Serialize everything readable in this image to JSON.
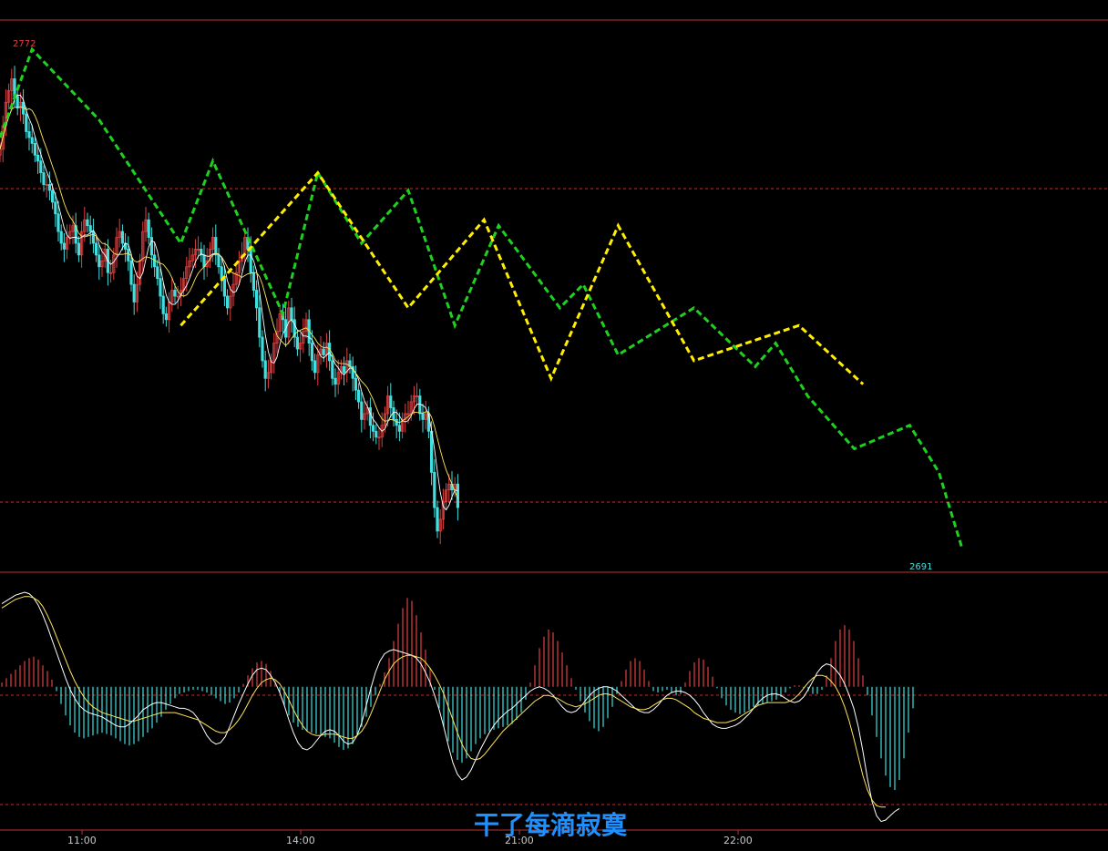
{
  "chart_data": {
    "type": "line",
    "price_panel": {
      "high_label": "2772",
      "low_label": "2691",
      "ylim": [
        2686,
        2780
      ],
      "close": [
        2758,
        2762,
        2766,
        2768,
        2770,
        2767,
        2765,
        2766,
        2764,
        2761,
        2760,
        2759,
        2757,
        2756,
        2754,
        2752,
        2752,
        2751,
        2749,
        2747,
        2744,
        2742,
        2741,
        2743,
        2744,
        2745,
        2742,
        2740,
        2744,
        2746,
        2745,
        2744,
        2742,
        2740,
        2738,
        2739,
        2741,
        2737,
        2737,
        2740,
        2743,
        2744,
        2742,
        2741,
        2739,
        2735,
        2732,
        2735,
        2739,
        2744,
        2746,
        2743,
        2740,
        2738,
        2736,
        2733,
        2730,
        2729,
        2732,
        2734,
        2733,
        2733,
        2734,
        2736,
        2738,
        2739,
        2740,
        2741,
        2741,
        2740,
        2738,
        2739,
        2741,
        2743,
        2740,
        2738,
        2736,
        2733,
        2731,
        2733,
        2735,
        2737,
        2739,
        2740,
        2743,
        2741,
        2737,
        2734,
        2731,
        2726,
        2722,
        2719,
        2720,
        2722,
        2725,
        2727,
        2730,
        2729,
        2726,
        2731,
        2729,
        2726,
        2724,
        2725,
        2727,
        2729,
        2725,
        2722,
        2720,
        2723,
        2724,
        2723,
        2725,
        2722,
        2719,
        2718,
        2720,
        2721,
        2720,
        2722,
        2721,
        2719,
        2717,
        2715,
        2712,
        2713,
        2714,
        2711,
        2710,
        2709,
        2709,
        2711,
        2713,
        2716,
        2714,
        2712,
        2711,
        2710,
        2712,
        2713,
        2713,
        2715,
        2716,
        2716,
        2713,
        2712,
        2713,
        2710,
        2703,
        2697,
        2693,
        2695,
        2698,
        2700,
        2701,
        2700,
        2701,
        2697
      ],
      "overlays": [
        {
          "name": "green_dashed",
          "color": "#1fd11f",
          "x": [
            0,
            11,
            34,
            62,
            73,
            97,
            109,
            124,
            140,
            156,
            171,
            192,
            200,
            212,
            238,
            259,
            266,
            277,
            293,
            312,
            322,
            330
          ],
          "y": [
            2760,
            2775,
            2763,
            2742,
            2756,
            2730,
            2754,
            2742,
            2751,
            2728,
            2745,
            2731,
            2735,
            2723,
            2731,
            2721,
            2725,
            2716,
            2707,
            2711,
            2703,
            2690
          ]
        },
        {
          "name": "yellow_dashed",
          "color": "#ffee00",
          "x": [
            62,
            109,
            140,
            166,
            189,
            212,
            238,
            274,
            296
          ],
          "y": [
            2728,
            2754,
            2731,
            2746,
            2719,
            2745,
            2722,
            2728,
            2718
          ]
        }
      ]
    },
    "macd_panel": {
      "ylim": [
        -10,
        8
      ],
      "histogram": [
        0.3,
        0.6,
        0.9,
        1.2,
        1.5,
        1.8,
        2.0,
        2.1,
        1.9,
        1.5,
        1.1,
        0.5,
        -0.3,
        -1.2,
        -2.0,
        -2.7,
        -3.2,
        -3.5,
        -3.6,
        -3.5,
        -3.4,
        -3.3,
        -3.2,
        -3.3,
        -3.4,
        -3.6,
        -3.8,
        -4.0,
        -4.1,
        -4.0,
        -3.8,
        -3.5,
        -3.2,
        -2.9,
        -2.5,
        -2.1,
        -1.6,
        -1.2,
        -0.8,
        -0.5,
        -0.4,
        -0.3,
        -0.2,
        -0.2,
        -0.3,
        -0.4,
        -0.6,
        -0.8,
        -1.0,
        -1.2,
        -1.1,
        -0.8,
        -0.4,
        0.2,
        0.8,
        1.3,
        1.7,
        1.8,
        1.6,
        1.1,
        0.4,
        -0.4,
        -1.3,
        -2.0,
        -2.5,
        -2.8,
        -3.0,
        -3.1,
        -3.2,
        -3.3,
        -3.4,
        -3.5,
        -3.6,
        -3.9,
        -4.2,
        -4.4,
        -4.3,
        -4.0,
        -3.4,
        -2.8,
        -2.1,
        -1.4,
        -0.6,
        0.2,
        1.0,
        2.0,
        3.2,
        4.4,
        5.5,
        6.2,
        6.0,
        5.0,
        3.8,
        2.6,
        1.3,
        -0.2,
        -1.5,
        -2.8,
        -3.8,
        -4.6,
        -5.1,
        -5.3,
        -5.0,
        -4.5,
        -4.0,
        -3.6,
        -3.3,
        -3.1,
        -3.0,
        -2.9,
        -2.8,
        -2.7,
        -2.6,
        -2.3,
        -1.8,
        -0.9,
        0.3,
        1.5,
        2.7,
        3.5,
        4.0,
        3.8,
        3.2,
        2.4,
        1.5,
        0.6,
        -0.2,
        -1.0,
        -1.8,
        -2.4,
        -2.9,
        -3.1,
        -2.8,
        -2.2,
        -1.4,
        -0.5,
        0.4,
        1.2,
        1.8,
        2.0,
        1.8,
        1.2,
        0.4,
        -0.3,
        -0.4,
        -0.3,
        -0.2,
        -0.4,
        -0.6,
        -0.5,
        0.3,
        1.1,
        1.7,
        2.0,
        1.9,
        1.4,
        0.7,
        -0.1,
        -0.8,
        -1.3,
        -1.6,
        -1.8,
        -1.9,
        -1.8,
        -1.6,
        -1.4,
        -1.3,
        -1.2,
        -1.1,
        -1.0,
        -0.9,
        -0.7,
        -0.4,
        -0.1,
        0.1,
        0.1,
        -0.1,
        -0.3,
        -0.5,
        -0.5,
        -0.2,
        0.8,
        2.0,
        3.2,
        4.0,
        4.3,
        4.0,
        3.2,
        2.0,
        0.8,
        -0.6,
        -2.0,
        -3.5,
        -5.0,
        -6.2,
        -7.0,
        -7.2,
        -6.5,
        -5.0,
        -3.2,
        -1.5
      ],
      "dif": [
        5.8,
        6.0,
        6.2,
        6.4,
        6.5,
        6.6,
        6.5,
        6.2,
        5.7,
        5.0,
        4.2,
        3.3,
        2.4,
        1.5,
        0.6,
        -0.2,
        -0.8,
        -1.3,
        -1.6,
        -1.8,
        -1.9,
        -2.0,
        -2.1,
        -2.3,
        -2.5,
        -2.7,
        -2.8,
        -2.8,
        -2.6,
        -2.3,
        -2.0,
        -1.6,
        -1.4,
        -1.2,
        -1.1,
        -1.1,
        -1.2,
        -1.3,
        -1.4,
        -1.5,
        -1.5,
        -1.6,
        -1.8,
        -2.2,
        -2.8,
        -3.4,
        -3.8,
        -4.0,
        -3.9,
        -3.5,
        -2.8,
        -2.0,
        -1.2,
        -0.5,
        0.2,
        0.8,
        1.2,
        1.3,
        1.2,
        0.8,
        0.3,
        -0.4,
        -1.3,
        -2.3,
        -3.2,
        -3.9,
        -4.3,
        -4.4,
        -4.2,
        -3.8,
        -3.4,
        -3.1,
        -3.0,
        -3.1,
        -3.4,
        -3.8,
        -4.0,
        -3.9,
        -3.4,
        -2.5,
        -1.3,
        -0.1,
        1.0,
        1.8,
        2.3,
        2.5,
        2.6,
        2.5,
        2.4,
        2.3,
        2.2,
        2.0,
        1.6,
        1.0,
        0.3,
        -0.6,
        -1.6,
        -2.8,
        -4.1,
        -5.3,
        -6.1,
        -6.5,
        -6.3,
        -5.8,
        -5.1,
        -4.4,
        -3.8,
        -3.2,
        -2.7,
        -2.3,
        -2.0,
        -1.7,
        -1.5,
        -1.2,
        -0.9,
        -0.6,
        -0.3,
        -0.1,
        0.0,
        -0.1,
        -0.3,
        -0.6,
        -1.0,
        -1.4,
        -1.7,
        -1.8,
        -1.7,
        -1.4,
        -1.0,
        -0.6,
        -0.3,
        -0.1,
        0.0,
        0.0,
        -0.1,
        -0.3,
        -0.6,
        -0.9,
        -1.2,
        -1.5,
        -1.7,
        -1.8,
        -1.8,
        -1.6,
        -1.3,
        -0.9,
        -0.6,
        -0.4,
        -0.3,
        -0.3,
        -0.4,
        -0.6,
        -0.9,
        -1.3,
        -1.8,
        -2.2,
        -2.6,
        -2.8,
        -2.9,
        -2.9,
        -2.8,
        -2.7,
        -2.5,
        -2.2,
        -1.9,
        -1.5,
        -1.1,
        -0.8,
        -0.6,
        -0.5,
        -0.5,
        -0.6,
        -0.8,
        -1.0,
        -1.1,
        -1.0,
        -0.7,
        -0.2,
        0.4,
        1.0,
        1.4,
        1.6,
        1.5,
        1.2,
        0.8,
        0.2,
        -0.6,
        -1.5,
        -2.8,
        -4.5,
        -6.4,
        -8.0,
        -9.0,
        -9.4,
        -9.3,
        -9.0,
        -8.7,
        -8.5
      ],
      "dea": [
        5.5,
        5.7,
        5.9,
        6.1,
        6.2,
        6.3,
        6.3,
        6.2,
        6.0,
        5.6,
        5.0,
        4.3,
        3.5,
        2.7,
        1.9,
        1.1,
        0.4,
        -0.2,
        -0.7,
        -1.1,
        -1.4,
        -1.6,
        -1.8,
        -1.9,
        -2.0,
        -2.1,
        -2.2,
        -2.3,
        -2.4,
        -2.4,
        -2.3,
        -2.2,
        -2.1,
        -2.0,
        -1.9,
        -1.8,
        -1.8,
        -1.8,
        -1.8,
        -1.9,
        -2.0,
        -2.1,
        -2.2,
        -2.3,
        -2.5,
        -2.7,
        -2.9,
        -3.1,
        -3.2,
        -3.2,
        -3.0,
        -2.7,
        -2.3,
        -1.8,
        -1.2,
        -0.6,
        -0.1,
        0.3,
        0.5,
        0.6,
        0.5,
        0.2,
        -0.3,
        -0.9,
        -1.6,
        -2.2,
        -2.7,
        -3.1,
        -3.3,
        -3.4,
        -3.4,
        -3.3,
        -3.3,
        -3.3,
        -3.4,
        -3.5,
        -3.6,
        -3.6,
        -3.4,
        -3.1,
        -2.6,
        -1.9,
        -1.1,
        -0.3,
        0.5,
        1.1,
        1.6,
        1.9,
        2.1,
        2.2,
        2.2,
        2.1,
        2.0,
        1.7,
        1.3,
        0.8,
        0.2,
        -0.5,
        -1.4,
        -2.3,
        -3.2,
        -4.0,
        -4.6,
        -5.0,
        -5.1,
        -5.0,
        -4.7,
        -4.3,
        -3.9,
        -3.5,
        -3.1,
        -2.8,
        -2.5,
        -2.2,
        -1.9,
        -1.6,
        -1.3,
        -1.0,
        -0.8,
        -0.6,
        -0.6,
        -0.7,
        -0.8,
        -1.0,
        -1.2,
        -1.3,
        -1.4,
        -1.3,
        -1.2,
        -1.0,
        -0.8,
        -0.6,
        -0.5,
        -0.5,
        -0.6,
        -0.8,
        -1.0,
        -1.2,
        -1.4,
        -1.5,
        -1.6,
        -1.6,
        -1.5,
        -1.3,
        -1.1,
        -0.9,
        -0.8,
        -0.8,
        -0.9,
        -1.1,
        -1.3,
        -1.5,
        -1.8,
        -2.0,
        -2.2,
        -2.3,
        -2.4,
        -2.5,
        -2.5,
        -2.5,
        -2.4,
        -2.3,
        -2.1,
        -1.9,
        -1.7,
        -1.5,
        -1.3,
        -1.2,
        -1.1,
        -1.1,
        -1.1,
        -1.1,
        -1.1,
        -1.0,
        -0.8,
        -0.5,
        -0.1,
        0.3,
        0.6,
        0.8,
        0.8,
        0.7,
        0.4,
        0.0,
        -0.6,
        -1.4,
        -2.4,
        -3.6,
        -4.9,
        -6.2,
        -7.2,
        -7.9,
        -8.3,
        -8.4,
        -8.4
      ]
    },
    "x_tick_labels": [
      "11:00",
      "14:00",
      "21:00",
      "22:00"
    ],
    "watermark": "干了每滴寂寞",
    "colors": {
      "up": "#e04040",
      "down": "#40e0e0",
      "ma_fast": "#ffffff",
      "ma_slow": "#ffe65a",
      "border": "#c03030",
      "grid": "#c03030",
      "label_high": "#e04040",
      "label_low": "#40e0e0"
    }
  }
}
